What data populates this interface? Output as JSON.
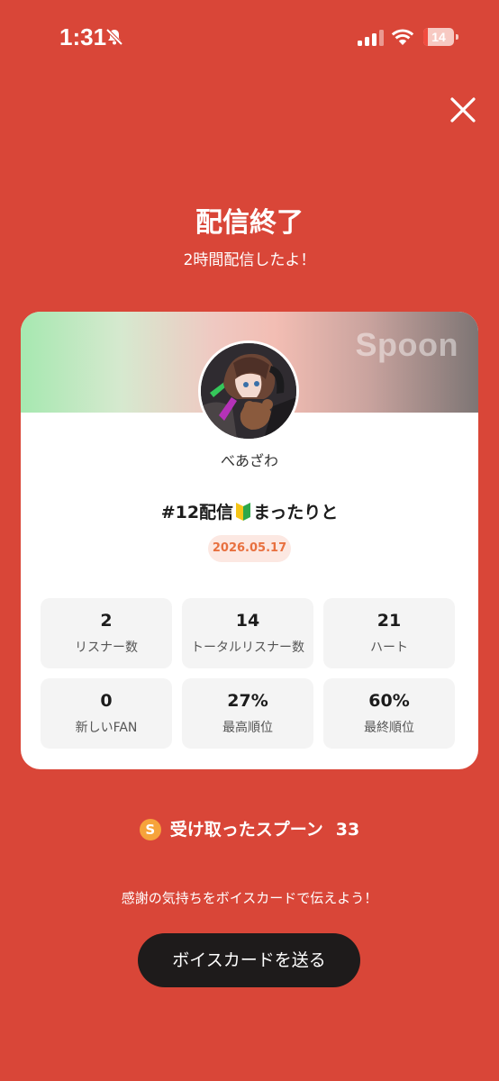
{
  "status_bar": {
    "time": "1:31",
    "battery_level": "14",
    "battery_fraction": 0.14,
    "silent_icon": "bell-slash-icon",
    "signal_icon": "cellular-signal-icon",
    "wifi_icon": "wifi-icon"
  },
  "header": {
    "close_icon": "close-icon",
    "title": "配信終了",
    "subtitle": "2時間配信したよ！"
  },
  "card": {
    "banner_logo": "Spoon",
    "username": "べあざわ",
    "stream_title_prefix": "#12配信",
    "stream_title_suffix": "まったりと",
    "stream_title_icon": "beginner-mark-icon",
    "date": "2026.05.17",
    "stats": [
      {
        "value": "2",
        "label": "リスナー数"
      },
      {
        "value": "14",
        "label": "トータルリスナー数"
      },
      {
        "value": "21",
        "label": "ハート"
      },
      {
        "value": "0",
        "label": "新しいFAN"
      },
      {
        "value": "27%",
        "label": "最高順位"
      },
      {
        "value": "60%",
        "label": "最終順位"
      }
    ]
  },
  "spoons": {
    "icon_letter": "S",
    "label": "受け取ったスプーン",
    "count": "33"
  },
  "footer": {
    "thanks_text": "感謝の気持ちをボイスカードで伝えよう！",
    "voice_card_button": "ボイスカードを送る"
  },
  "colors": {
    "background": "#D94638",
    "button": "#1E1B1B",
    "date_text": "#E8703F",
    "coin": "#F6A33B"
  }
}
